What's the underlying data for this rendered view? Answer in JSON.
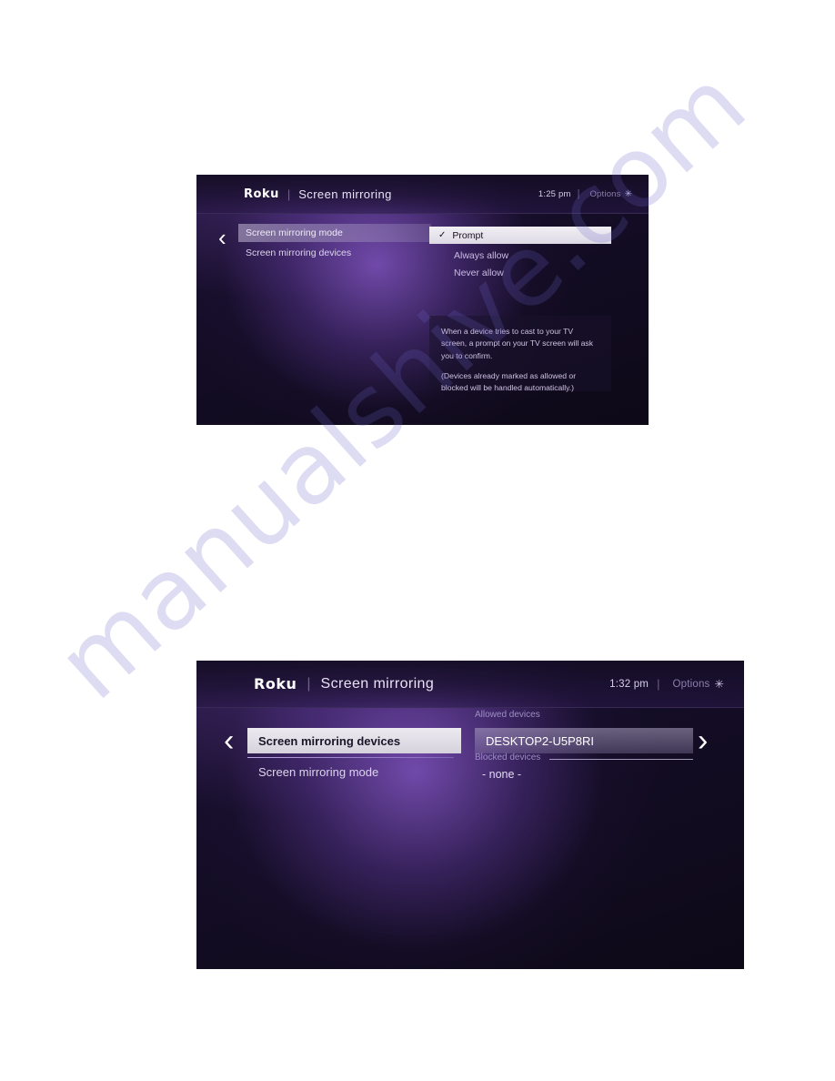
{
  "page": {
    "background_color": "#ffffff",
    "watermark_text": "manualshive.com",
    "watermark_color": "#6b63c9"
  },
  "screens": [
    {
      "id": "screen-mirroring-mode",
      "header": {
        "logo": "Roku",
        "divider": "|",
        "title": "Screen mirroring",
        "time": "1:25 pm",
        "options_label": "Options",
        "options_icon": "✳"
      },
      "nav": {
        "left_chevron": "‹",
        "right_chevron": "›"
      },
      "menu": [
        {
          "label": "Screen mirroring mode",
          "selected": true
        },
        {
          "label": "Screen mirroring devices",
          "selected": false
        }
      ],
      "options": [
        {
          "label": "Prompt",
          "checked": true,
          "check_glyph": "✓"
        },
        {
          "label": "Always allow",
          "checked": false
        },
        {
          "label": "Never allow",
          "checked": false
        }
      ],
      "description": [
        "When a device tries to cast to your TV screen, a prompt on your TV screen will ask you to confirm.",
        "(Devices already marked as allowed or blocked will be handled automatically.)"
      ]
    },
    {
      "id": "screen-mirroring-devices",
      "header": {
        "logo": "Roku",
        "divider": "|",
        "title": "Screen mirroring",
        "time": "1:32 pm",
        "options_label": "Options",
        "options_icon": "✳"
      },
      "nav": {
        "left_chevron": "‹",
        "right_chevron": "›"
      },
      "menu": [
        {
          "label": "Screen mirroring devices",
          "selected": true
        },
        {
          "label": "Screen mirroring mode",
          "selected": false
        }
      ],
      "devices": {
        "allowed_label": "Allowed devices",
        "allowed_items": [
          "DESKTOP2-U5P8RI"
        ],
        "blocked_label": "Blocked devices",
        "blocked_items": [
          "- none -"
        ]
      }
    }
  ]
}
